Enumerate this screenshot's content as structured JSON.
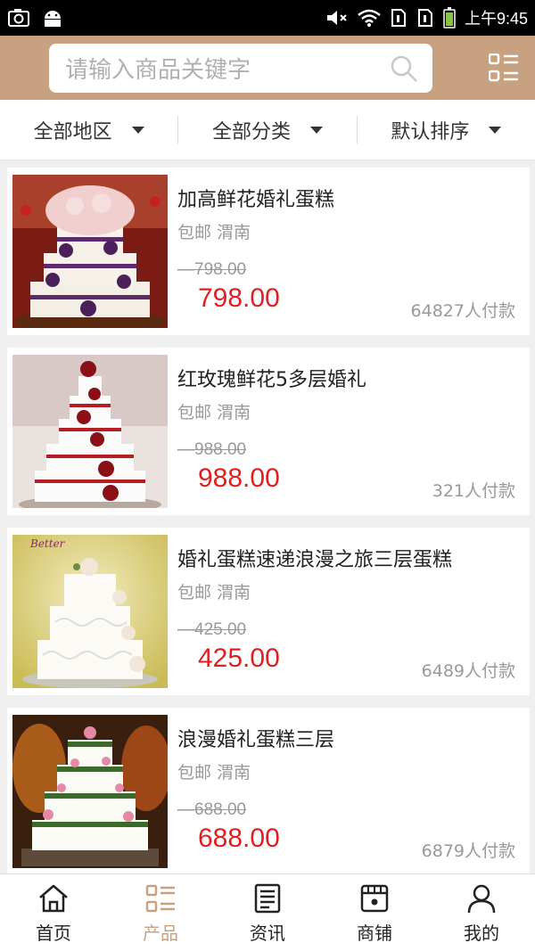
{
  "status_bar": {
    "time": "上午9:45",
    "icons": [
      "camera-icon",
      "android-icon",
      "mute-icon",
      "wifi-icon",
      "sim1-icon",
      "sim2-icon",
      "battery-icon"
    ]
  },
  "header": {
    "search_placeholder": "请输入商品关键字",
    "search_icon": "search-icon",
    "menu_icon": "list-menu-icon",
    "background_color": "#c8a180"
  },
  "filters": [
    {
      "label": "全部地区"
    },
    {
      "label": "全部分类"
    },
    {
      "label": "默认排序"
    }
  ],
  "products": [
    {
      "title": "加高鲜花婚礼蛋糕",
      "meta": "包邮 渭南",
      "old_price": "798.00",
      "price": "798.00",
      "sales": "64827人付款"
    },
    {
      "title": "红玫瑰鲜花5多层婚礼",
      "meta": "包邮 渭南",
      "old_price": "988.00",
      "price": "988.00",
      "sales": "321人付款"
    },
    {
      "title": "婚礼蛋糕速递浪漫之旅三层蛋糕",
      "meta": "包邮 渭南",
      "old_price": "425.00",
      "price": "425.00",
      "sales": "6489人付款"
    },
    {
      "title": "浪漫婚礼蛋糕三层",
      "meta": "包邮 渭南",
      "old_price": "688.00",
      "price": "688.00",
      "sales": "6879人付款"
    }
  ],
  "bottom_nav": [
    {
      "label": "首页",
      "icon": "home-icon"
    },
    {
      "label": "产品",
      "icon": "product-list-icon",
      "active": true
    },
    {
      "label": "资讯",
      "icon": "news-icon"
    },
    {
      "label": "商铺",
      "icon": "store-icon"
    },
    {
      "label": "我的",
      "icon": "user-icon"
    }
  ],
  "colors": {
    "accent": "#c8a180",
    "price": "#e02020"
  }
}
